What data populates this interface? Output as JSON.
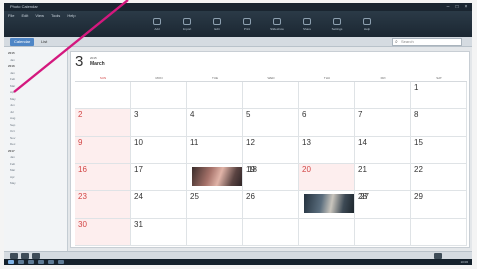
{
  "window": {
    "title": "Photo Calendar"
  },
  "menu": [
    "File",
    "Edit",
    "View",
    "Tools",
    "Help"
  ],
  "toolbar": [
    "Add",
    "Import",
    "Edit",
    "Print",
    "Slideshow",
    "Share",
    "Settings",
    "Help"
  ],
  "tabs": {
    "calendar": "Calendar",
    "list": "List"
  },
  "search": {
    "placeholder": "Search"
  },
  "sidebar": {
    "rows": [
      {
        "label": "2015",
        "year": true
      },
      {
        "label": "Jan",
        "year": false
      },
      {
        "label": "2016",
        "year": true
      },
      {
        "label": "Jan",
        "year": false
      },
      {
        "label": "Feb",
        "year": false
      },
      {
        "label": "Mar",
        "year": false
      },
      {
        "label": "Apr",
        "year": false
      },
      {
        "label": "May",
        "year": false
      },
      {
        "label": "Jun",
        "year": false
      },
      {
        "label": "Jul",
        "year": false
      },
      {
        "label": "Aug",
        "year": false
      },
      {
        "label": "Sep",
        "year": false
      },
      {
        "label": "Oct",
        "year": false
      },
      {
        "label": "Nov",
        "year": false
      },
      {
        "label": "Dec",
        "year": false
      },
      {
        "label": "2017",
        "year": true
      },
      {
        "label": "Jan",
        "year": false
      },
      {
        "label": "Feb",
        "year": false
      },
      {
        "label": "Mar",
        "year": false
      },
      {
        "label": "Apr",
        "year": false
      },
      {
        "label": "May",
        "year": false
      }
    ]
  },
  "month": {
    "number": "3",
    "year": "2015",
    "name": "March"
  },
  "weekdays": [
    "SUN",
    "MON",
    "TUE",
    "WED",
    "THU",
    "FRI",
    "SAT"
  ],
  "weeks": [
    [
      null,
      null,
      null,
      null,
      null,
      null,
      "1"
    ],
    [
      "2",
      "3",
      "4",
      "5",
      "6",
      "7",
      "8"
    ],
    [
      "9",
      "10",
      "11",
      "12",
      "13",
      "14",
      "15"
    ],
    [
      "16",
      "17",
      "18",
      "19",
      "20",
      "21",
      "22"
    ],
    [
      "23",
      "24",
      "25",
      "26",
      "27",
      "28",
      "29"
    ],
    [
      "30",
      "31",
      null,
      null,
      null,
      null,
      null
    ]
  ],
  "holidays": [
    "20"
  ],
  "photos": [
    "18",
    "27"
  ],
  "taskbar": {
    "clock": "10:06"
  },
  "colors": {
    "accent": "#4f86c6",
    "sunday": "#d24545",
    "annotation": "#d4187e"
  }
}
